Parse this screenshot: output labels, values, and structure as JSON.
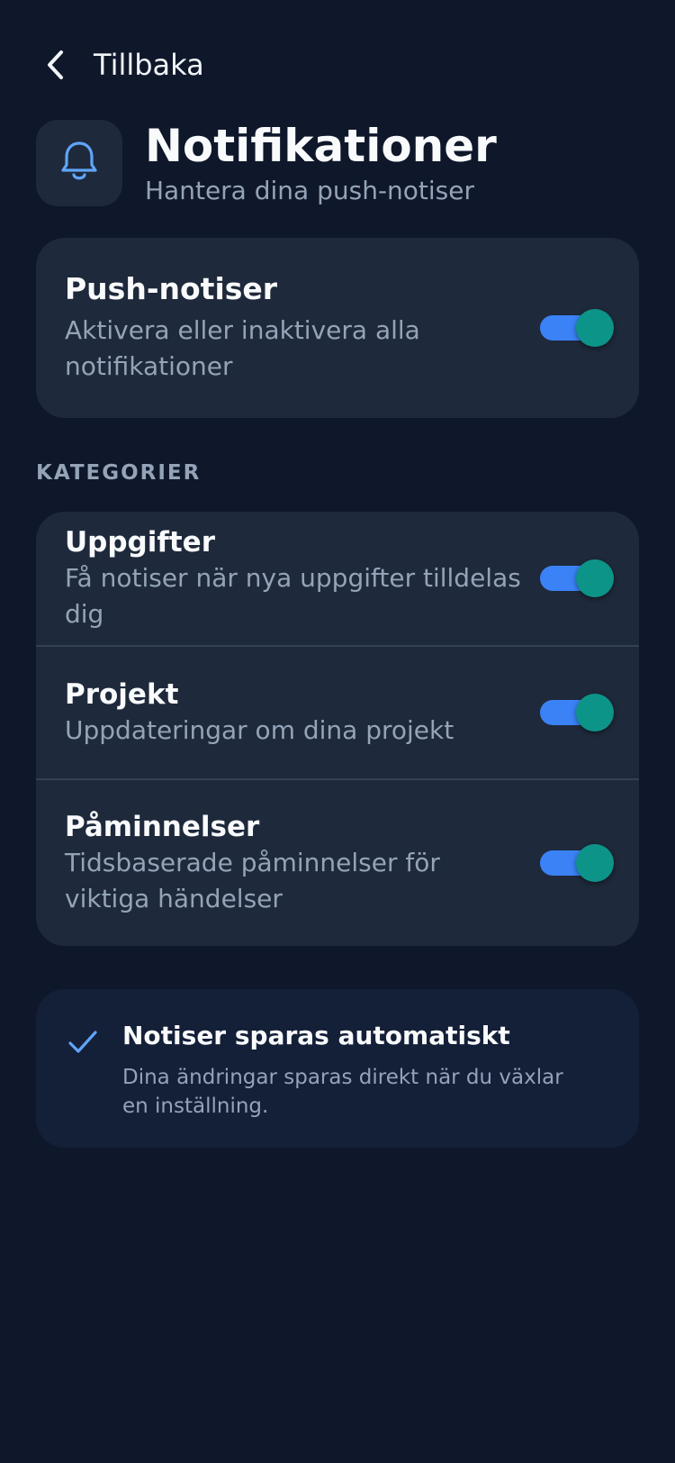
{
  "nav": {
    "back_label": "Tillbaka",
    "back_icon": "chevron-left-icon"
  },
  "header": {
    "icon": "bell-icon",
    "title": "Notifikationer",
    "subtitle": "Hantera dina push-notiser"
  },
  "master": {
    "title": "Push-notiser",
    "description": "Aktivera eller inaktivera alla notifikationer",
    "enabled": true
  },
  "categories": {
    "section_label": "KATEGORIER",
    "items": [
      {
        "title": "Uppgifter",
        "description": "Få notiser när nya uppgifter tilldelas dig",
        "enabled": true
      },
      {
        "title": "Projekt",
        "description": "Uppdateringar om dina projekt",
        "enabled": true
      },
      {
        "title": "Påminnelser",
        "description": "Tidsbaserade påminnelser för viktiga händelser",
        "enabled": true
      }
    ]
  },
  "info": {
    "icon": "check-icon",
    "title": "Notiser sparas automatiskt",
    "description": "Dina ändringar sparas direkt när du växlar en inställning."
  },
  "colors": {
    "background": "#0f172a",
    "card": "#1e293b",
    "toggle_track": "#3b82f6",
    "toggle_knob": "#0d9488",
    "accent": "#60a5fa",
    "muted_text": "#94a3b8"
  }
}
